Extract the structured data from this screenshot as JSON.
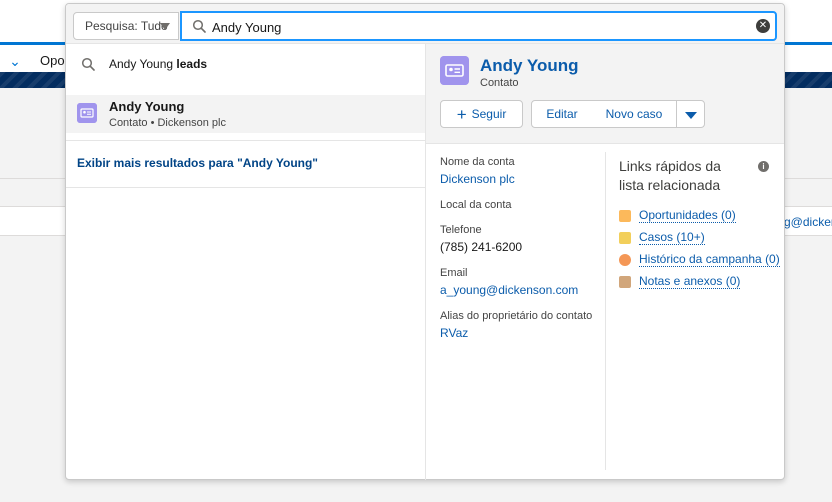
{
  "background": {
    "nav_partial_label": "Opo",
    "row_email_fragment": "g@dicker"
  },
  "search": {
    "scope_label": "Pesquisa: Tudo",
    "query": "Andy Young"
  },
  "suggestion": {
    "prefix": "Andy Young",
    "suffix": "leads"
  },
  "result": {
    "name": "Andy Young",
    "subtitle": "Contato • Dickenson plc"
  },
  "more_results_label": "Exibir mais resultados para \"Andy Young\"",
  "preview": {
    "name": "Andy Young",
    "type": "Contato",
    "buttons": {
      "follow": "Seguir",
      "edit": "Editar",
      "new_case": "Novo caso"
    },
    "fields": [
      {
        "label": "Nome da conta",
        "value": "Dickenson plc",
        "link": true
      },
      {
        "label": "Local da conta",
        "value": "",
        "link": false
      },
      {
        "label": "Telefone",
        "value": "(785) 241-6200",
        "link": false
      },
      {
        "label": "Email",
        "value": "a_young@dickenson.com",
        "link": true
      },
      {
        "label": "Alias do proprietário do contato",
        "value": "RVaz",
        "link": true
      }
    ],
    "quick_links": {
      "title": "Links rápidos da lista relacionada",
      "items": [
        {
          "label": "Oportunidades (0)",
          "color": "#fcb95b"
        },
        {
          "label": "Casos (10+)",
          "color": "#f2cf5b"
        },
        {
          "label": "Histórico da campanha (0)",
          "color": "#f49756"
        },
        {
          "label": "Notas e anexos (0)",
          "color": "#d1a67b"
        }
      ]
    }
  },
  "colors": {
    "accent": "#1b96ff",
    "link": "#0b5cab",
    "contact_icon": "#a094ed",
    "nav_band": "#032d60"
  }
}
